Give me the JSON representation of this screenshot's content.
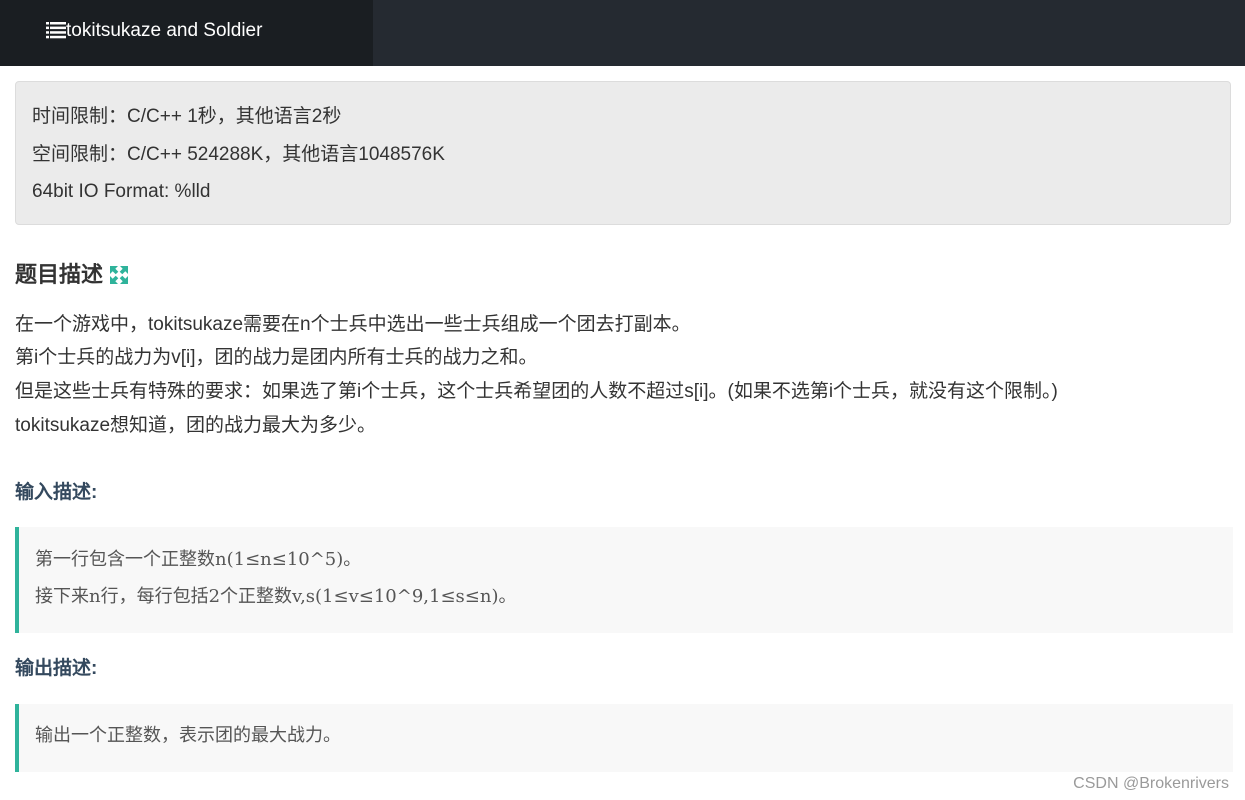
{
  "header": {
    "title": "tokitsukaze and Soldier",
    "icon": "list-icon"
  },
  "limits": {
    "time": "时间限制：C/C++ 1秒，其他语言2秒",
    "memory": "空间限制：C/C++ 524288K，其他语言1048576K",
    "io_format": "64bit IO Format: %lld"
  },
  "description": {
    "title": "题目描述",
    "icon": "expand-icon",
    "accent_color": "#2fb39b",
    "lines": [
      "在一个游戏中，tokitsukaze需要在n个士兵中选出一些士兵组成一个团去打副本。",
      "第i个士兵的战力为v[i]，团的战力是团内所有士兵的战力之和。",
      "但是这些士兵有特殊的要求：如果选了第i个士兵，这个士兵希望团的人数不超过s[i]。(如果不选第i个士兵，就没有这个限制。)",
      "tokitsukaze想知道，团的战力最大为多少。"
    ]
  },
  "input": {
    "title": "输入描述:",
    "lines": [
      "第一行包含一个正整数n(1≤n≤10^5)。",
      "接下来n行，每行包括2个正整数v,s(1≤v≤10^9,1≤s≤n)。"
    ]
  },
  "output": {
    "title": "输出描述:",
    "lines": [
      "输出一个正整数，表示团的最大战力。"
    ]
  },
  "watermark": "CSDN @Brokenrivers"
}
